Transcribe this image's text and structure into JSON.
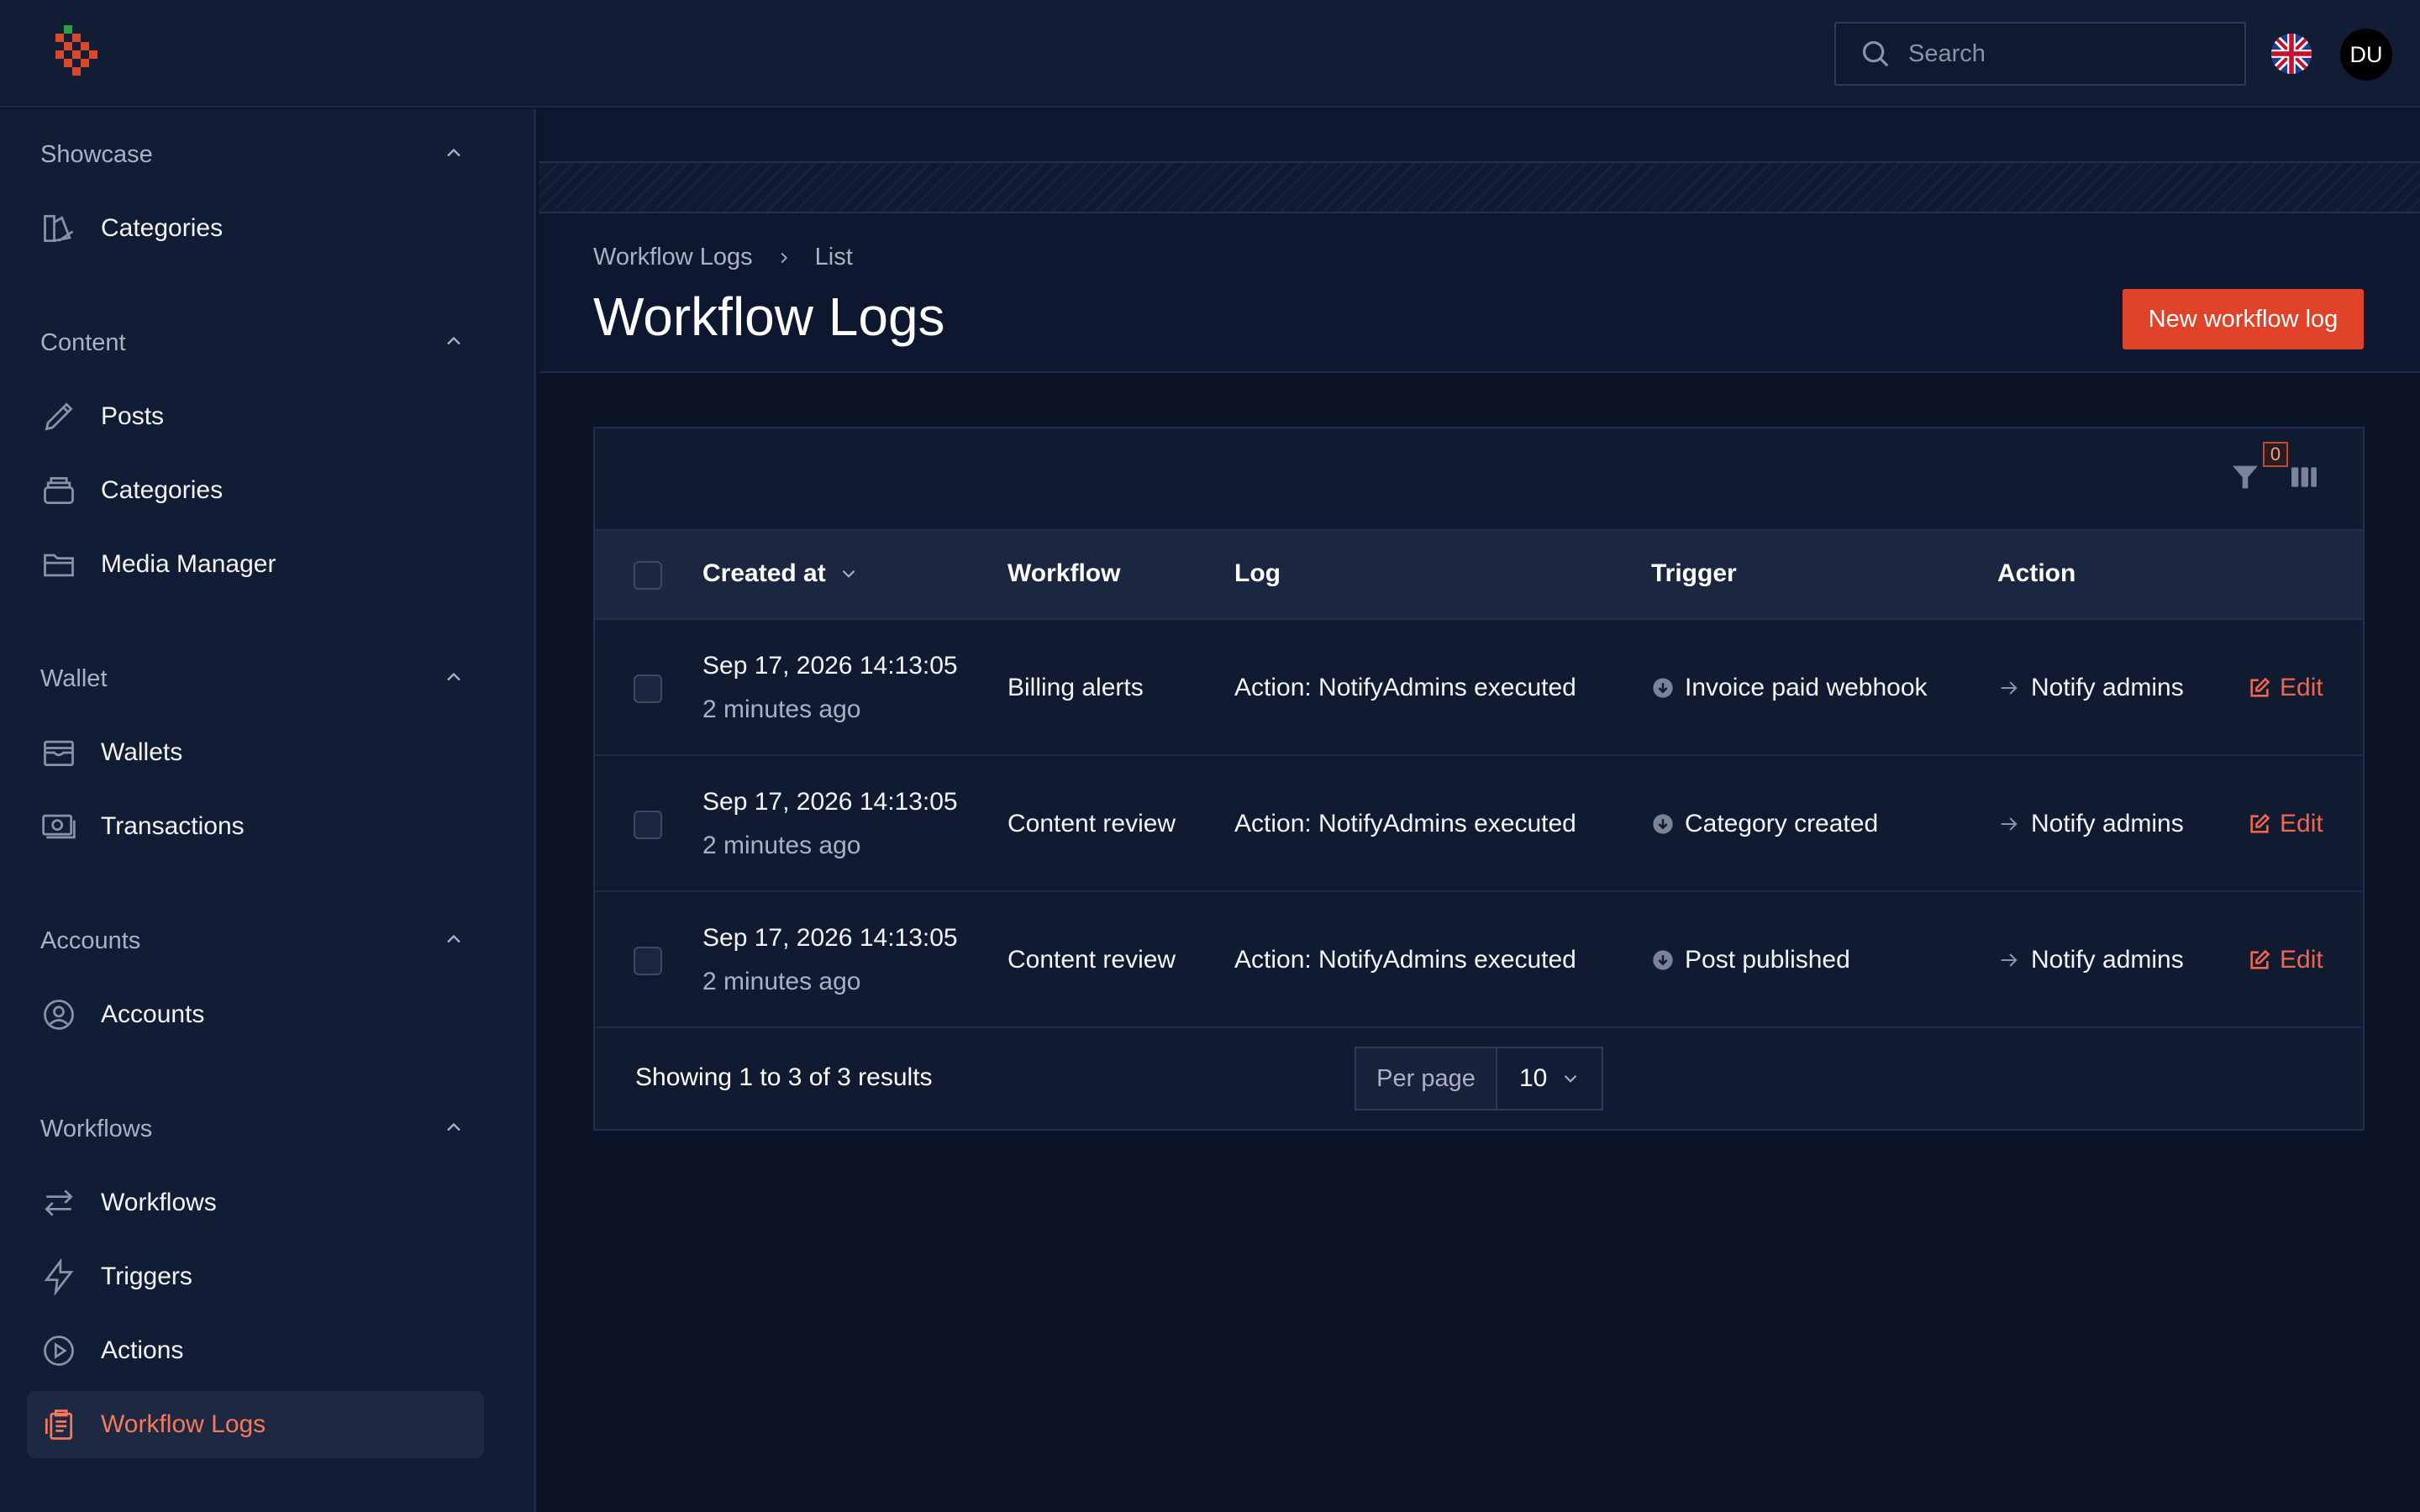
{
  "topbar": {
    "search_placeholder": "Search",
    "avatar_initials": "DU"
  },
  "sidebar": {
    "groups": [
      {
        "title": "Showcase",
        "items": [
          {
            "label": "Categories",
            "icon": "categories-icon"
          }
        ]
      },
      {
        "title": "Content",
        "items": [
          {
            "label": "Posts",
            "icon": "pencil-icon"
          },
          {
            "label": "Categories",
            "icon": "stack-icon"
          },
          {
            "label": "Media Manager",
            "icon": "folder-icon"
          }
        ]
      },
      {
        "title": "Wallet",
        "items": [
          {
            "label": "Wallets",
            "icon": "wallet-icon"
          },
          {
            "label": "Transactions",
            "icon": "banknote-icon"
          }
        ]
      },
      {
        "title": "Accounts",
        "items": [
          {
            "label": "Accounts",
            "icon": "user-circle-icon"
          }
        ]
      },
      {
        "title": "Workflows",
        "items": [
          {
            "label": "Workflows",
            "icon": "arrows-icon"
          },
          {
            "label": "Triggers",
            "icon": "bolt-icon"
          },
          {
            "label": "Actions",
            "icon": "play-circle-icon"
          },
          {
            "label": "Workflow Logs",
            "icon": "clipboard-icon",
            "active": true
          }
        ]
      }
    ]
  },
  "page": {
    "breadcrumb": [
      "Workflow Logs",
      "List"
    ],
    "title": "Workflow Logs",
    "new_button": "New workflow log",
    "filter_count": "0"
  },
  "table": {
    "columns": [
      "Created at",
      "Workflow",
      "Log",
      "Trigger",
      "Action"
    ],
    "rows": [
      {
        "created": "Sep 17, 2026 14:13:05",
        "relative": "2 minutes ago",
        "workflow": "Billing alerts",
        "log": "Action: NotifyAdmins executed",
        "trigger": "Invoice paid webhook",
        "action": "Notify admins",
        "edit": "Edit"
      },
      {
        "created": "Sep 17, 2026 14:13:05",
        "relative": "2 minutes ago",
        "workflow": "Content review",
        "log": "Action: NotifyAdmins executed",
        "trigger": "Category created",
        "action": "Notify admins",
        "edit": "Edit"
      },
      {
        "created": "Sep 17, 2026 14:13:05",
        "relative": "2 minutes ago",
        "workflow": "Content review",
        "log": "Action: NotifyAdmins executed",
        "trigger": "Post published",
        "action": "Notify admins",
        "edit": "Edit"
      }
    ],
    "footer": "Showing 1 to 3 of 3 results",
    "per_page_label": "Per page",
    "per_page_value": "10"
  },
  "colors": {
    "accent": "#e0432a",
    "link": "#f4654a",
    "background": "#0b1326"
  }
}
